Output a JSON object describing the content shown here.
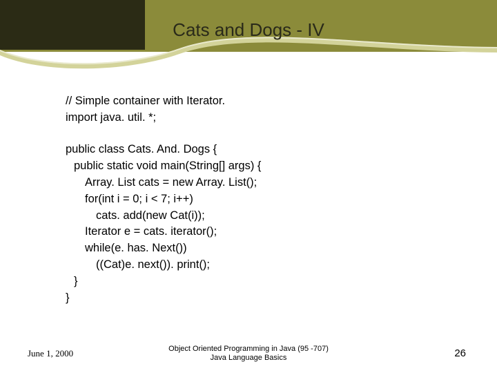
{
  "slide": {
    "title": "Cats and Dogs - IV"
  },
  "code": {
    "l0": "// Simple container with Iterator.",
    "l1": "import java. util. *;",
    "l2": "public class Cats. And. Dogs {",
    "l3": "public static void main(String[] args) {",
    "l4": "Array. List cats = new Array. List();",
    "l5": "for(int i = 0; i < 7; i++)",
    "l6": "cats. add(new Cat(i));",
    "l7": "Iterator e = cats. iterator();",
    "l8": "while(e. has. Next())",
    "l9": "((Cat)e. next()). print();",
    "l10": "}",
    "l11": "}"
  },
  "footer": {
    "date": "June 1, 2000",
    "center1": "Object Oriented Programming in Java  (95 -707)",
    "center2": "Java Language Basics",
    "page": "26"
  }
}
